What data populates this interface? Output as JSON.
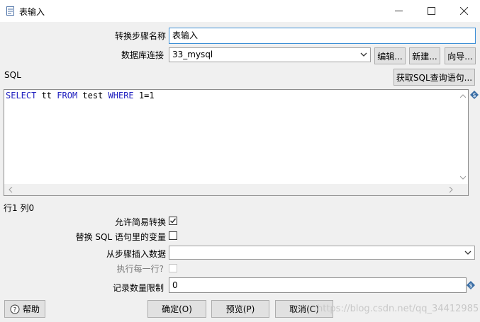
{
  "window": {
    "title": "表输入"
  },
  "form": {
    "step_name_label": "转换步骤名称",
    "step_name_value": "表输入",
    "connection_label": "数据库连接",
    "connection_value": "33_mysql",
    "edit_button": "编辑...",
    "new_button": "新建...",
    "wizard_button": "向导...",
    "sql_label": "SQL",
    "get_sql_button": "获取SQL查询语句...",
    "sql_text": "SELECT tt FROM test WHERE 1=1",
    "sql_tokens": {
      "select": "SELECT",
      "col": " tt ",
      "from": "FROM",
      "table": " test ",
      "where": "WHERE",
      "cond": " 1=1"
    },
    "cursor_position": "行1 列0",
    "lazy_conversion_label": "允许简易转换",
    "lazy_conversion_checked": true,
    "replace_vars_label": "替换 SQL 语句里的变量",
    "replace_vars_checked": false,
    "insert_from_step_label": "从步骤插入数据",
    "insert_from_step_value": "",
    "execute_each_row_label": "执行每一行?",
    "execute_each_row_checked": false,
    "limit_label": "记录数量限制",
    "limit_value": "0"
  },
  "footer": {
    "help_button": "帮助",
    "ok_button": "确定(O)",
    "preview_button": "预览(P)",
    "cancel_button": "取消(C)",
    "watermark": "https://blog.csdn.net/qq_34412985"
  }
}
